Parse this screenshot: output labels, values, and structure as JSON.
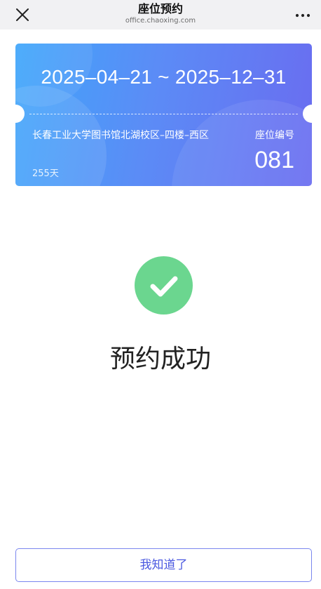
{
  "nav": {
    "title": "座位预约",
    "subtitle": "office.chaoxing.com",
    "close_icon": "close-icon",
    "more_icon": "more-icon"
  },
  "ticket": {
    "date_range": "2025–04–21 ~ 2025–12–31",
    "location": "长春工业大学图书馆北湖校区–四楼–西区",
    "days": "255天",
    "seat_label": "座位编号",
    "seat_number": "081",
    "gradient_colors": [
      "#3fa6fb",
      "#5b8cf6",
      "#6a6cf0"
    ]
  },
  "result": {
    "icon": "checkmark-icon",
    "icon_color": "#6bd68f",
    "message": "预约成功"
  },
  "actions": {
    "ok_label": "我知道了",
    "accent_color": "#4b59e0"
  }
}
